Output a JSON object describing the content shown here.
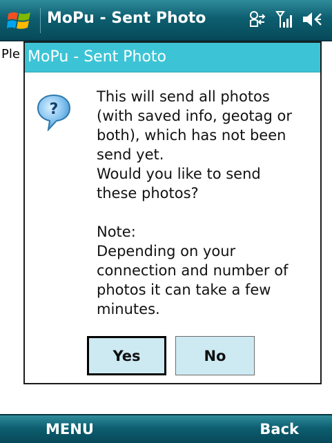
{
  "window": {
    "title": "MoPu - Sent Photo"
  },
  "background": {
    "partial_text": "Ple"
  },
  "dialog": {
    "title": "MoPu - Sent Photo",
    "message_lines": [
      "This will send all photos",
      "(with saved info, geotag or",
      "both), which has not been",
      "send yet.",
      "Would you like to send",
      "these photos?"
    ],
    "note_lines": [
      "Note:",
      "Depending on your",
      "connection and number of",
      "photos it can take a few",
      "minutes."
    ],
    "yes_label": "Yes",
    "no_label": "No"
  },
  "softkeys": {
    "left": "MENU",
    "right": "Back"
  },
  "status_icons": [
    "connectivity-icon",
    "signal-icon",
    "volume-icon"
  ],
  "colors": {
    "titlebar": "#0d5f70",
    "dialog_header": "#3cc4d6",
    "button_bg": "#cdeaf3"
  }
}
